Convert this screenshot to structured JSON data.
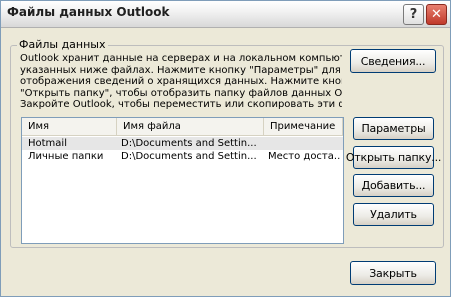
{
  "window": {
    "title": "Файлы данных Outlook",
    "help_label": "?",
    "close_label": "✕"
  },
  "group": {
    "label": "Файлы данных",
    "info_lines": [
      "Outlook хранит данные на серверах и на локальном компьютере в",
      "указанных ниже файлах. Нажмите кнопку \"Параметры\" для",
      "отображения сведений о хранящихся данных. Нажмите кнопку",
      "\"Открыть папку\", чтобы отобразить папку файлов данных Outlook.",
      "Закройте Outlook, чтобы переместить или скопировать эти файлы."
    ]
  },
  "buttons": {
    "details": "Сведения...",
    "settings": "Параметры",
    "open_folder": "Открыть папку...",
    "add": "Добавить...",
    "remove": "Удалить",
    "close": "Закрыть"
  },
  "table": {
    "columns": [
      "Имя",
      "Имя файла",
      "Примечание"
    ],
    "rows": [
      [
        "Hotmail",
        "D:\\Documents and Settin...",
        ""
      ],
      [
        "Личные папки",
        "D:\\Documents and Settin...",
        "Место доста..."
      ]
    ]
  }
}
